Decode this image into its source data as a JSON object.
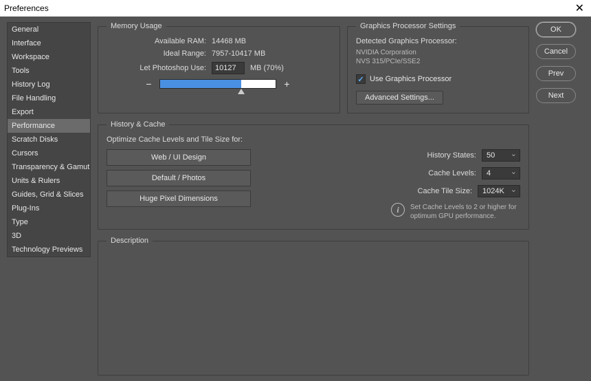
{
  "window": {
    "title": "Preferences"
  },
  "sidebar": {
    "items": [
      "General",
      "Interface",
      "Workspace",
      "Tools",
      "History Log",
      "File Handling",
      "Export",
      "Performance",
      "Scratch Disks",
      "Cursors",
      "Transparency & Gamut",
      "Units & Rulers",
      "Guides, Grid & Slices",
      "Plug-Ins",
      "Type",
      "3D",
      "Technology Previews"
    ],
    "selected": "Performance"
  },
  "memory": {
    "legend": "Memory Usage",
    "available_label": "Available RAM:",
    "available_value": "14468 MB",
    "ideal_label": "Ideal Range:",
    "ideal_value": "7957-10417 MB",
    "let_label": "Let Photoshop Use:",
    "let_value": "10127",
    "unit_pct": "MB (70%)",
    "minus": "−",
    "plus": "+"
  },
  "gpu": {
    "legend": "Graphics Processor Settings",
    "detected_label": "Detected Graphics Processor:",
    "vendor": "NVIDIA Corporation",
    "model": "NVS 315/PCIe/SSE2",
    "use_label": "Use Graphics Processor",
    "advanced": "Advanced Settings..."
  },
  "history": {
    "legend": "History & Cache",
    "optimize_label": "Optimize Cache Levels and Tile Size for:",
    "opts": [
      "Web / UI Design",
      "Default / Photos",
      "Huge Pixel Dimensions"
    ],
    "states_label": "History States:",
    "states_value": "50",
    "levels_label": "Cache Levels:",
    "levels_value": "4",
    "tile_label": "Cache Tile Size:",
    "tile_value": "1024K",
    "info": "Set Cache Levels to 2 or higher for optimum GPU performance.",
    "info_icon": "i"
  },
  "description": {
    "legend": "Description"
  },
  "buttons": {
    "ok": "OK",
    "cancel": "Cancel",
    "prev": "Prev",
    "next": "Next"
  }
}
